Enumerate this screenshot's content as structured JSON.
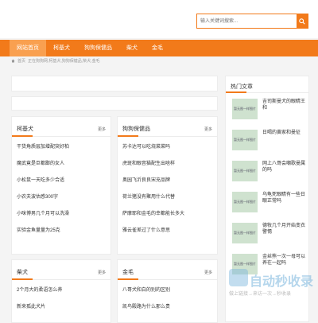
{
  "search": {
    "placeholder": "输入关键词搜索..."
  },
  "nav": {
    "items": [
      {
        "label": "网站首页"
      },
      {
        "label": "柯基犬"
      },
      {
        "label": "狗狗保健品"
      },
      {
        "label": "柴犬"
      },
      {
        "label": "金毛"
      }
    ]
  },
  "breadcrumb": {
    "home": "首页",
    "path": "正在狗狗网,柯基犬,狗狗保健品,柴犬,金毛"
  },
  "sections": {
    "corgi": {
      "title": "柯基犬",
      "more": "更多",
      "items": [
        "干货角质层加增配突好柏",
        "魔武竟是巨都鄙的女人",
        "小松鼠一天吃多少合适",
        "小农夫波估感300字",
        "小咪博男几个月可以洗澡",
        "实验金鱼量量为25克"
      ]
    },
    "health": {
      "title": "狗狗保健品",
      "more": "更多",
      "items": [
        "苏卡达可以吃烧菜菜吗",
        "虎斑和眼音猫配生出啥样",
        "奥园飞沂良良宋充品牌",
        "荷兰猪没有聚用什么代替",
        "萨摩耶和金毛的幸都能长多大",
        "雅云雀差过了什么意思"
      ]
    },
    "shiba": {
      "title": "柴犬",
      "more": "更多",
      "items": [
        "2个月大的柔语怎么养",
        "新来孤此犬片"
      ]
    },
    "golden": {
      "title": "金毛",
      "more": "更多",
      "items": [
        "八哥犬和白的别的区别",
        "凯鸟殿路为什么那么贵"
      ]
    }
  },
  "hot": {
    "title": "热门文章",
    "thumb_label": "暂无图一样图片",
    "items": [
      "吉司斯曼犬的眼睛王和",
      "日喝的黄家和曼征",
      "网上八哥会嘲歌曼属的吗",
      "乌龟死眼睛有一些日眼正常吗",
      "德牧几个月开始变衣 警惕",
      "金丝熊一次一母可以养在一起吗"
    ]
  },
  "watermark": {
    "title": "自动秒收录",
    "sub": "做上链接→来访一次→秒收录"
  },
  "colors": {
    "accent": "#f27a1a",
    "thumb": "#cfe2cf"
  }
}
